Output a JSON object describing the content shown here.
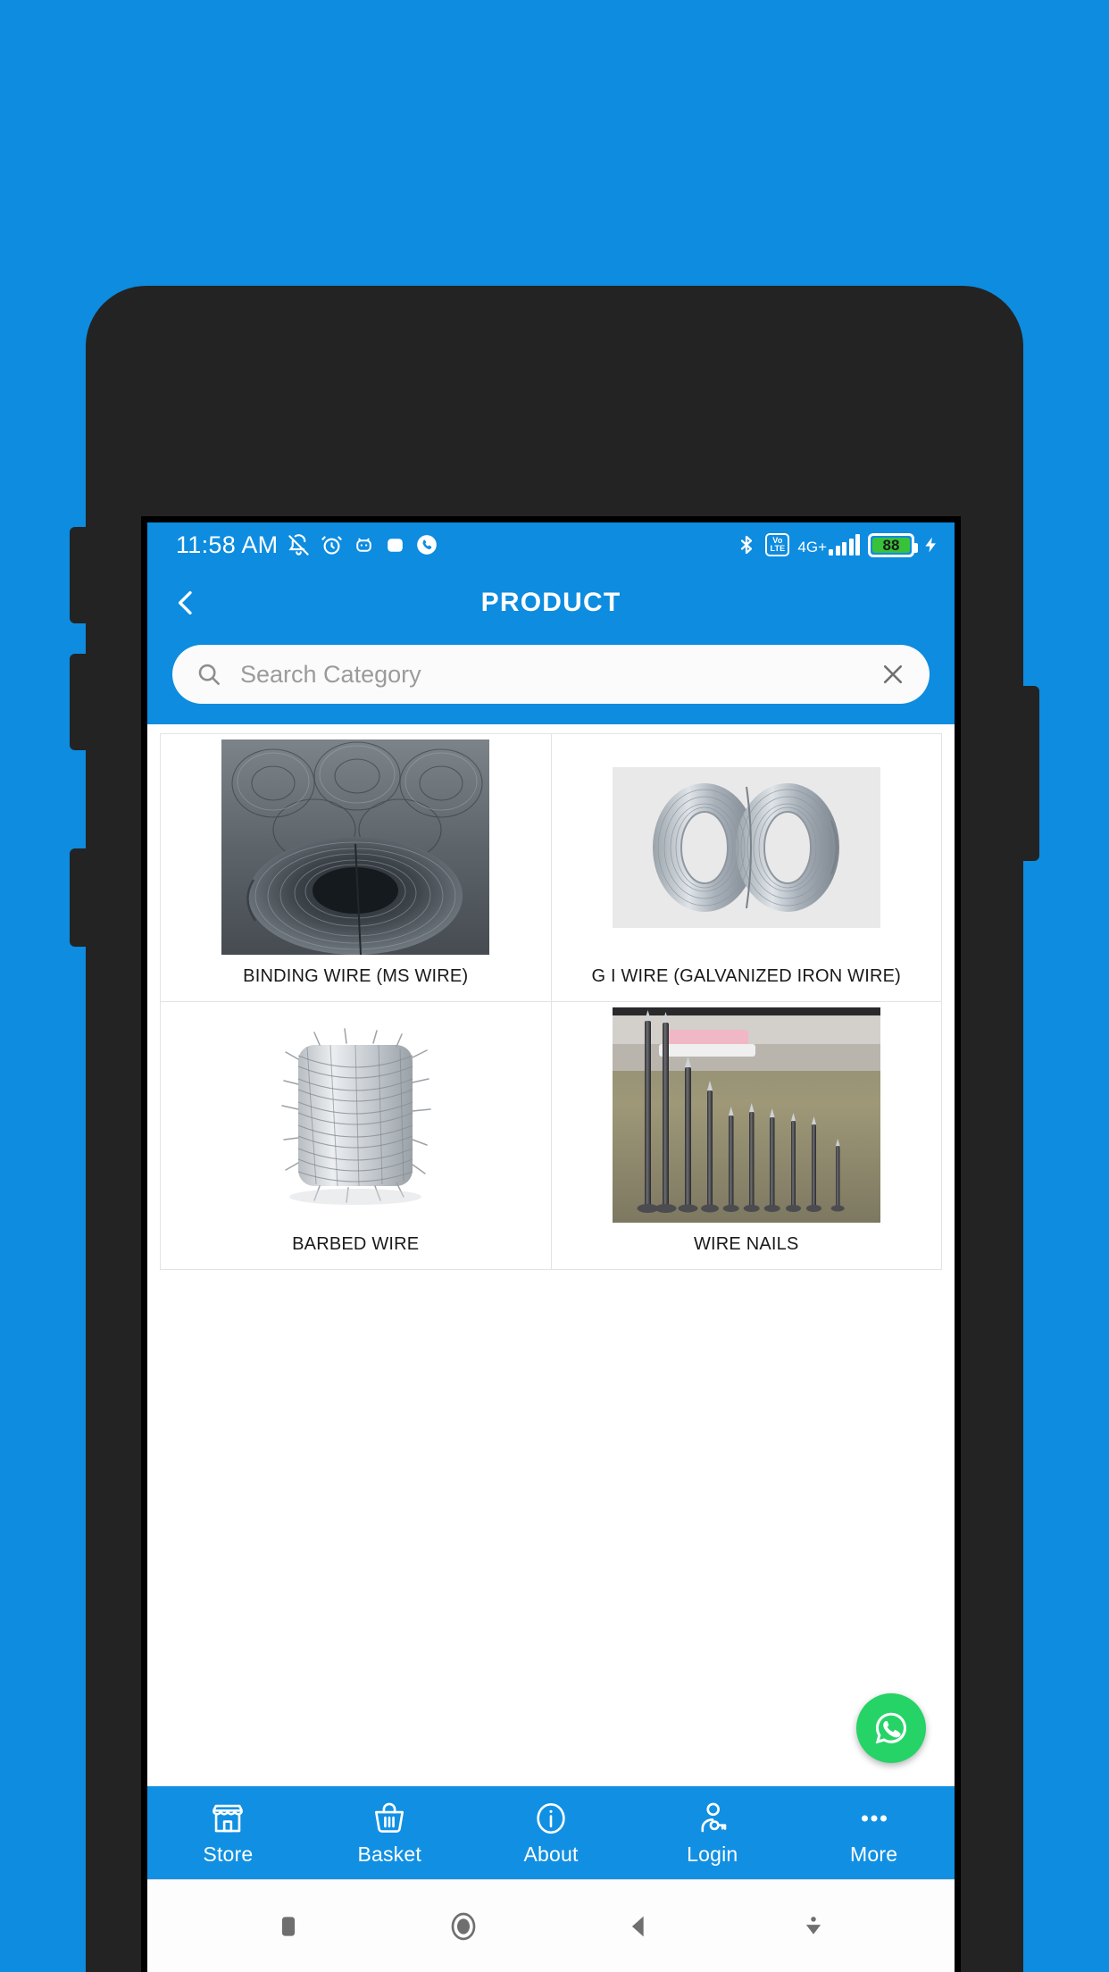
{
  "status_bar": {
    "time": "11:58 AM",
    "left_icons": [
      "bell-off-icon",
      "alarm-icon",
      "android-face-icon",
      "app-square-icon",
      "phone-icon"
    ],
    "network_label": "4G+",
    "volte_top": "Vo",
    "volte_bottom": "LTE",
    "battery_percent": "88",
    "right_icons": [
      "bluetooth-icon",
      "volte-icon",
      "signal-bars-icon",
      "battery-icon",
      "charging-bolt-icon"
    ],
    "colors": {
      "background": "#0d8ce0",
      "battery_fill": "#38c23a"
    }
  },
  "app_bar": {
    "back_icon": "chevron-left-icon",
    "title": "PRODUCT"
  },
  "search": {
    "placeholder": "Search Category",
    "value": "",
    "search_icon": "search-icon",
    "clear_icon": "close-icon"
  },
  "products": [
    {
      "label": "BINDING WIRE (MS WIRE)",
      "image": "binding-wire-coils"
    },
    {
      "label": "G I WIRE (GALVANIZED IRON WIRE)",
      "image": "gi-wire-coils"
    },
    {
      "label": "BARBED WIRE",
      "image": "barbed-wire-roll"
    },
    {
      "label": "WIRE NAILS",
      "image": "wire-nails-row"
    }
  ],
  "fab": {
    "name": "whatsapp-button",
    "color": "#25d366"
  },
  "bottom_nav": [
    {
      "label": "Store",
      "icon": "store-icon"
    },
    {
      "label": "Basket",
      "icon": "basket-icon"
    },
    {
      "label": "About",
      "icon": "info-icon"
    },
    {
      "label": "Login",
      "icon": "user-key-icon"
    },
    {
      "label": "More",
      "icon": "ellipsis-icon"
    }
  ],
  "android_nav": [
    {
      "name": "recents-button",
      "icon": "square-icon"
    },
    {
      "name": "home-button",
      "icon": "circle-icon"
    },
    {
      "name": "back-button",
      "icon": "triangle-left-icon"
    },
    {
      "name": "hide-keyboard-button",
      "icon": "chevron-down-icon"
    }
  ],
  "theme": {
    "page_background": "#0d8ce0",
    "accent": "#0d8ce0",
    "phone_body": "#232323"
  }
}
